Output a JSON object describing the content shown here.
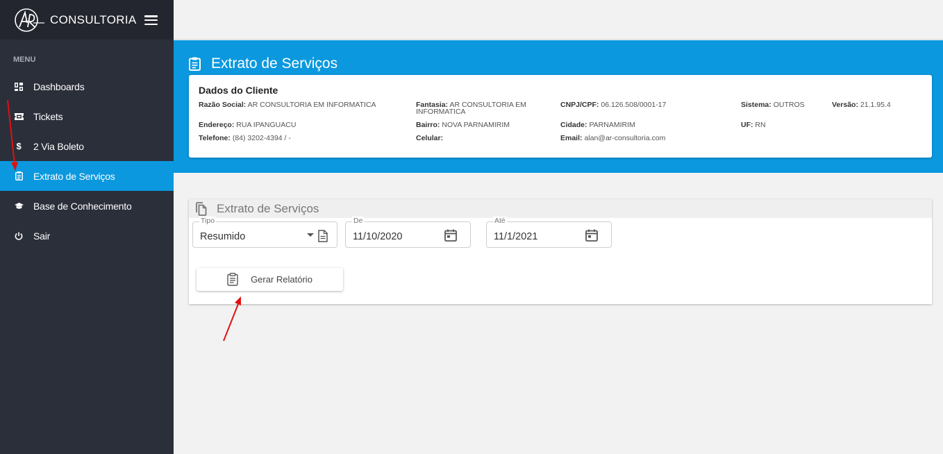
{
  "brand": {
    "name": "CONSULTORIA",
    "logo_text": "AR"
  },
  "sidebar": {
    "menu_header": "MENU",
    "items": [
      {
        "label": "Dashboards",
        "icon": "dashboard-icon"
      },
      {
        "label": "Tickets",
        "icon": "ticket-icon"
      },
      {
        "label": "2 Via Boleto",
        "icon": "dollar-icon"
      },
      {
        "label": "Extrato de Serviços",
        "icon": "clipboard-icon",
        "active": true
      },
      {
        "label": "Base de Conhecimento",
        "icon": "graduation-cap-icon"
      },
      {
        "label": "Sair",
        "icon": "power-icon"
      }
    ]
  },
  "page": {
    "title": "Extrato de Serviços"
  },
  "client": {
    "title": "Dados do Cliente",
    "razao_social_label": "Razão Social:",
    "razao_social": "AR CONSULTORIA EM INFORMATICA",
    "fantasia_label": "Fantasia:",
    "fantasia_line1": "AR CONSULTORIA EM",
    "fantasia_line2": "INFORMATICA",
    "cnpj_label": "CNPJ/CPF:",
    "cnpj": "06.126.508/0001-17",
    "sistema_label": "Sistema:",
    "sistema": "OUTROS",
    "versao_label": "Versão:",
    "versao": "21.1.95.4",
    "endereco_label": "Endereço:",
    "endereco": "RUA IPANGUACU",
    "bairro_label": "Bairro:",
    "bairro": "NOVA PARNAMIRIM",
    "cidade_label": "Cidade:",
    "cidade": "PARNAMIRIM",
    "uf_label": "UF:",
    "uf": "RN",
    "telefone_label": "Telefone:",
    "telefone": "(84) 3202-4394 / -",
    "celular_label": "Celular:",
    "celular": "",
    "email_label": "Email:",
    "email": "alan@ar-consultoria.com"
  },
  "report": {
    "title": "Extrato de Serviços",
    "tipo_label": "Tipo",
    "tipo_value": "Resumido",
    "de_label": "De",
    "de_value": "11/10/2020",
    "ate_label": "Até",
    "ate_value": "11/1/2021",
    "button_label": "Gerar Relatório"
  },
  "colors": {
    "accent": "#0b98de",
    "sidebar": "#2b2f3a",
    "annotation": "#e01010"
  }
}
